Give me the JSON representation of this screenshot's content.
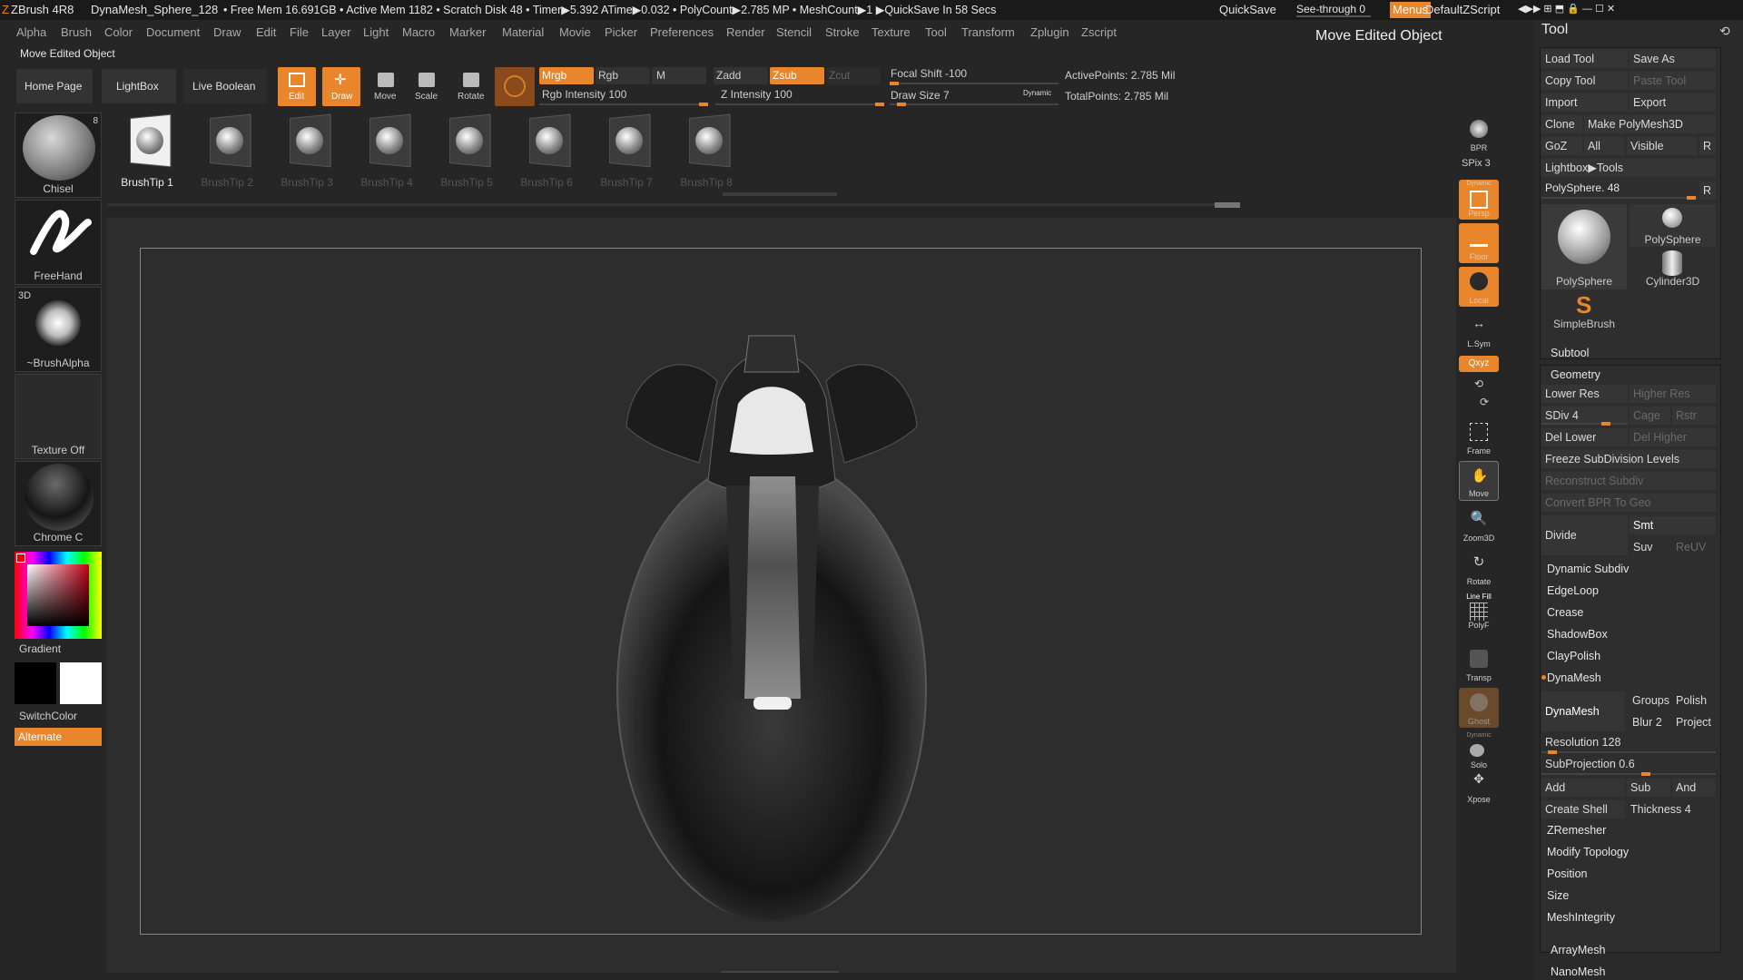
{
  "titlebar": {
    "app": "ZBrush 4R8",
    "doc": "DynaMesh_Sphere_128",
    "stats": "• Free Mem 16.691GB • Active Mem 1182 • Scratch Disk 48 •  Timer▶5.392 ATime▶0.032 • PolyCount▶2.785 MP  • MeshCount▶1  ▶QuickSave In 58 Secs",
    "quicksave": "QuickSave",
    "seethrough": "See-through  0",
    "menus": "Menus",
    "script": "DefaultZScript"
  },
  "menubar": [
    "Alpha",
    "Brush",
    "Color",
    "Document",
    "Draw",
    "Edit",
    "File",
    "Layer",
    "Light",
    "Macro",
    "Marker",
    "Material",
    "Movie",
    "Picker",
    "Preferences",
    "Render",
    "Stencil",
    "Stroke",
    "Texture",
    "Tool",
    "Transform",
    "Zplugin",
    "Zscript"
  ],
  "status_label": "Move Edited Object",
  "header_title": "Move Edited Object",
  "shelf": {
    "home": "Home Page",
    "lightbox": "LightBox",
    "liveboolean": "Live Boolean",
    "edit": "Edit",
    "draw": "Draw",
    "move": "Move",
    "scale": "Scale",
    "rotate": "Rotate",
    "mrgb": "Mrgb",
    "rgb": "Rgb",
    "m": "M",
    "zadd": "Zadd",
    "zsub": "Zsub",
    "zcut": "Zcut",
    "rgb_intensity": "Rgb Intensity 100",
    "z_intensity": "Z Intensity 100",
    "focal_shift": "Focal Shift -100",
    "draw_size": "Draw Size 7",
    "dynamic": "Dynamic",
    "active_points": "ActivePoints: 2.785 Mil",
    "total_points": "TotalPoints: 2.785 Mil"
  },
  "left": {
    "chisel": "Chisel",
    "chisel_count": "8",
    "freehand": "FreeHand",
    "alpha_3d": "3D",
    "brushalpha": "~BrushAlpha",
    "texture": "Texture Off",
    "material": "Chrome C",
    "gradient": "Gradient",
    "switchcolor": "SwitchColor",
    "alternate": "Alternate"
  },
  "brushtips": [
    "BrushTip 1",
    "BrushTip 2",
    "BrushTip 3",
    "BrushTip 4",
    "BrushTip 5",
    "BrushTip 6",
    "BrushTip 7",
    "BrushTip 8"
  ],
  "righttb": {
    "bpr": "BPR",
    "spix": "SPix 3",
    "dynamic": "Dynamic",
    "persp": "Persp",
    "floor": "Floor",
    "local": "Local",
    "lsym": "L.Sym",
    "xyz": "Qxyz",
    "frame": "Frame",
    "move": "Move",
    "zoom": "Zoom3D",
    "rotate": "Rotate",
    "linefill": "Line Fill",
    "polyf": "PolyF",
    "transp": "Transp",
    "ghost": "Ghost",
    "dynamic2": "Dynamic",
    "solo": "Solo",
    "xpose": "Xpose"
  },
  "toolpanel": {
    "title": "Tool",
    "load": "Load Tool",
    "saveas": "Save As",
    "copy": "Copy Tool",
    "paste": "Paste Tool",
    "import": "Import",
    "export": "Export",
    "clone": "Clone",
    "makepoly": "Make PolyMesh3D",
    "goz": "GoZ",
    "all": "All",
    "visible": "Visible",
    "r": "R",
    "lightbox_tools": "Lightbox▶Tools",
    "polysphere_slider": "PolySphere. 48",
    "r2": "R",
    "polysphere": "PolySphere",
    "polysphere2": "PolySphere",
    "cylinder": "Cylinder3D",
    "simplebrush": "SimpleBrush",
    "subtool": "Subtool",
    "geometry": "Geometry",
    "lowerres": "Lower Res",
    "higherres": "Higher Res",
    "sdiv": "SDiv 4",
    "cage": "Cage",
    "rstr": "Rstr",
    "dellower": "Del Lower",
    "delhigher": "Del Higher",
    "freeze": "Freeze SubDivision Levels",
    "reconstruct": "Reconstruct Subdiv",
    "convertbpr": "Convert BPR To Geo",
    "divide": "Divide",
    "smt": "Smt",
    "suv": "Suv",
    "reuv": "ReUV",
    "dynamicsubdiv": "Dynamic Subdiv",
    "edgeloop": "EdgeLoop",
    "crease": "Crease",
    "shadowbox": "ShadowBox",
    "claypolish": "ClayPolish",
    "dynamesh_head": "DynaMesh",
    "dynamesh_btn": "DynaMesh",
    "groups": "Groups",
    "polish": "Polish",
    "blur": "Blur 2",
    "project": "Project",
    "resolution": "Resolution 128",
    "subprojection": "SubProjection 0.6",
    "add": "Add",
    "sub": "Sub",
    "and": "And",
    "createshell": "Create Shell",
    "thickness": "Thickness 4",
    "zremesher": "ZRemesher",
    "modify": "Modify Topology",
    "position": "Position",
    "size": "Size",
    "meshintegrity": "MeshIntegrity",
    "arraymesh": "ArrayMesh",
    "nanomesh": "NanoMesh"
  },
  "sliders": {
    "rgb_intensity": 1.0,
    "z_intensity": 1.0,
    "draw_size": 0.07,
    "sdiv": 0.75,
    "resolution": 0.06,
    "subprojection": 0.6,
    "polysphere": 0.96
  }
}
